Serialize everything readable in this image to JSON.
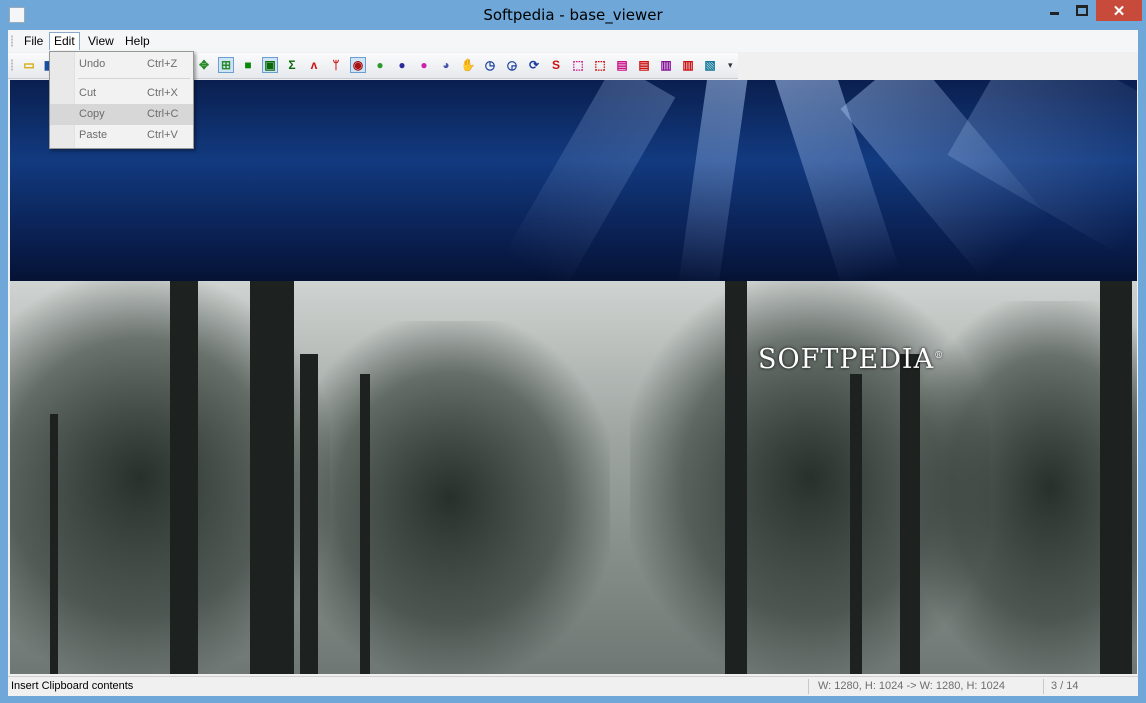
{
  "window": {
    "title": "Softpedia - base_viewer",
    "close_glyph": "✕",
    "colors": {
      "titlebar": "#6ea7d8",
      "close": "#c74a3b"
    }
  },
  "menubar": {
    "items": [
      {
        "label": "File"
      },
      {
        "label": "Edit"
      },
      {
        "label": "View"
      },
      {
        "label": "Help"
      }
    ]
  },
  "edit_menu": {
    "items": [
      {
        "label": "Undo",
        "shortcut": "Ctrl+Z"
      },
      {
        "label": "Cut",
        "shortcut": "Ctrl+X"
      },
      {
        "label": "Copy",
        "shortcut": "Ctrl+C"
      },
      {
        "label": "Paste",
        "shortcut": "Ctrl+V"
      }
    ]
  },
  "toolbar": {
    "icons": [
      {
        "name": "open-icon",
        "glyph": "▭",
        "color": "#d4a800"
      },
      {
        "name": "save-icon",
        "glyph": "▮",
        "color": "#1a4fa0"
      },
      {
        "name": "move-icon",
        "glyph": "✥",
        "color": "#2a8a2a"
      },
      {
        "name": "fit-icon",
        "glyph": "⊞",
        "color": "#2a8a2a"
      },
      {
        "name": "rectangle-icon",
        "glyph": "■",
        "color": "#0a8a0a"
      },
      {
        "name": "image-frame-icon",
        "glyph": "▣",
        "color": "#0a6a0a"
      },
      {
        "name": "sigma-icon",
        "glyph": "Σ",
        "color": "#0a6a0a"
      },
      {
        "name": "mountain-icon",
        "glyph": "ʌ",
        "color": "#cc1111"
      },
      {
        "name": "trees-icon",
        "glyph": "ᛘ",
        "color": "#cc1111"
      },
      {
        "name": "record-icon",
        "glyph": "◉",
        "color": "#aa1111"
      },
      {
        "name": "globe-green-icon",
        "glyph": "●",
        "color": "#2a9a2a"
      },
      {
        "name": "globe-blue-icon",
        "glyph": "●",
        "color": "#2a2a9a"
      },
      {
        "name": "globe-magenta-icon",
        "glyph": "●",
        "color": "#cc22aa"
      },
      {
        "name": "eye-icon",
        "glyph": "◕",
        "color": "#4455aa"
      },
      {
        "name": "hand-icon",
        "glyph": "✋",
        "color": "#cc1111"
      },
      {
        "name": "clock-icon",
        "glyph": "◷",
        "color": "#1a3fa0"
      },
      {
        "name": "clock-alt-icon",
        "glyph": "◶",
        "color": "#1a3fa0"
      },
      {
        "name": "refresh-icon",
        "glyph": "⟳",
        "color": "#1a3fa0"
      },
      {
        "name": "snake-icon",
        "glyph": "S",
        "color": "#cc1111"
      },
      {
        "name": "select-icon",
        "glyph": "⬚",
        "color": "#cc2288"
      },
      {
        "name": "select-add-icon",
        "glyph": "⬚",
        "color": "#cc1111"
      },
      {
        "name": "layer-up-icon",
        "glyph": "▤",
        "color": "#cc1188"
      },
      {
        "name": "layer-down-icon",
        "glyph": "▤",
        "color": "#cc1111"
      },
      {
        "name": "layer-group-icon",
        "glyph": "▥",
        "color": "#881199"
      },
      {
        "name": "layer-merge-icon",
        "glyph": "▥",
        "color": "#cc1111"
      },
      {
        "name": "film-icon",
        "glyph": "▧",
        "color": "#117799"
      }
    ],
    "overflow_glyph": "▾"
  },
  "canvas": {
    "logo_text": "SOFTPEDIA",
    "logo_mark": "®"
  },
  "statusbar": {
    "message": "Insert Clipboard contents",
    "dimensions": "W: 1280, H: 1024 -> W: 1280, H: 1024",
    "page": "3 / 14"
  }
}
